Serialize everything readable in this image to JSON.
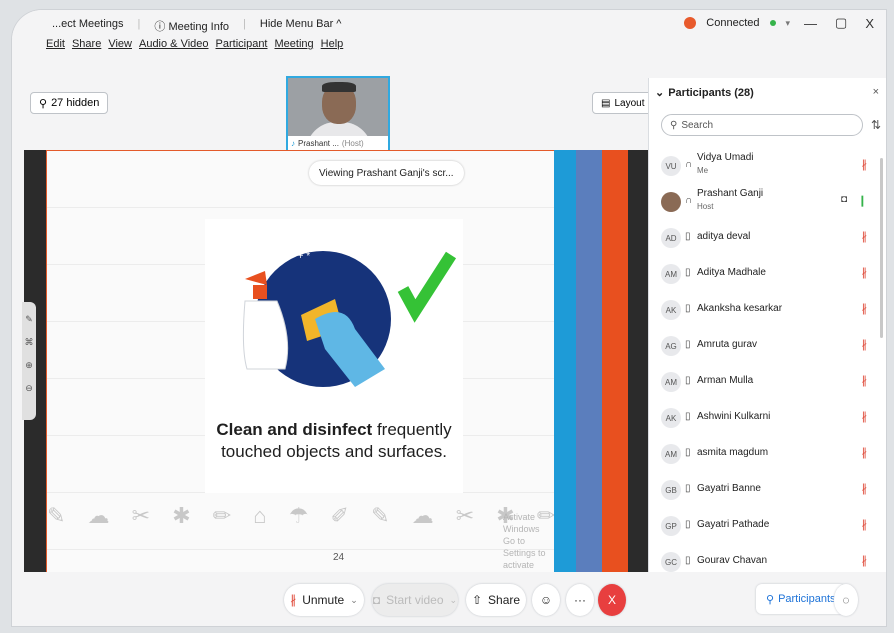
{
  "titlebar": {
    "app_partial": "...ect Meetings",
    "meeting_info": "Meeting Info",
    "hide_menu": "Hide Menu Bar ^",
    "status": "Connected",
    "minimize": "—",
    "restore": "▢",
    "close": "X"
  },
  "menu": [
    "Edit",
    "Share",
    "View",
    "Audio & Video",
    "Participant",
    "Meeting",
    "Help"
  ],
  "toolbar": {
    "hidden_label": "27 hidden",
    "layout_label": "Layout"
  },
  "thumbnail": {
    "name": "Prashant ...",
    "role": "(Host)"
  },
  "share": {
    "viewing_label": "Viewing Prashant Ganji's scr...",
    "poster_bold": "Clean and disinfect",
    "poster_rest1": " frequently",
    "poster_rest2": "touched objects and surfaces.",
    "page_number": "24",
    "watermark_line1": "Activate Windows",
    "watermark_line2": "Go to Settings to activate Windows."
  },
  "bottom": {
    "unmute": "Unmute",
    "start_video": "Start video",
    "share": "Share",
    "more": "···",
    "end": "X",
    "participants_btn": "Participants"
  },
  "participants": {
    "title": "Participants (28)",
    "search_placeholder": "Search",
    "list": [
      {
        "initials": "VU",
        "name": "Vidya Umadi",
        "sub": "Me",
        "mic": "muted"
      },
      {
        "initials": "",
        "name": "Prashant Ganji",
        "sub": "Host",
        "mic": "on"
      },
      {
        "initials": "AD",
        "name": "aditya deval",
        "sub": "",
        "mic": "muted"
      },
      {
        "initials": "AM",
        "name": "Aditya Madhale",
        "sub": "",
        "mic": "muted"
      },
      {
        "initials": "AK",
        "name": "Akanksha kesarkar",
        "sub": "",
        "mic": "muted"
      },
      {
        "initials": "AG",
        "name": "Amruta gurav",
        "sub": "",
        "mic": "muted"
      },
      {
        "initials": "AM",
        "name": "Arman Mulla",
        "sub": "",
        "mic": "muted"
      },
      {
        "initials": "AK",
        "name": "Ashwini Kulkarni",
        "sub": "",
        "mic": "muted"
      },
      {
        "initials": "AM",
        "name": "asmita magdum",
        "sub": "",
        "mic": "muted"
      },
      {
        "initials": "GB",
        "name": "Gayatri Banne",
        "sub": "",
        "mic": "muted"
      },
      {
        "initials": "GP",
        "name": "Gayatri Pathade",
        "sub": "",
        "mic": "muted"
      },
      {
        "initials": "GC",
        "name": "Gourav Chavan",
        "sub": "",
        "mic": "muted"
      }
    ]
  },
  "colors": {
    "accent_blue": "#1e73d8",
    "end_red": "#e83f3f",
    "stripe_orange": "#e8501f",
    "stripe_blue": "#1e9bd7",
    "stripe_slate": "#5b7ebd"
  }
}
